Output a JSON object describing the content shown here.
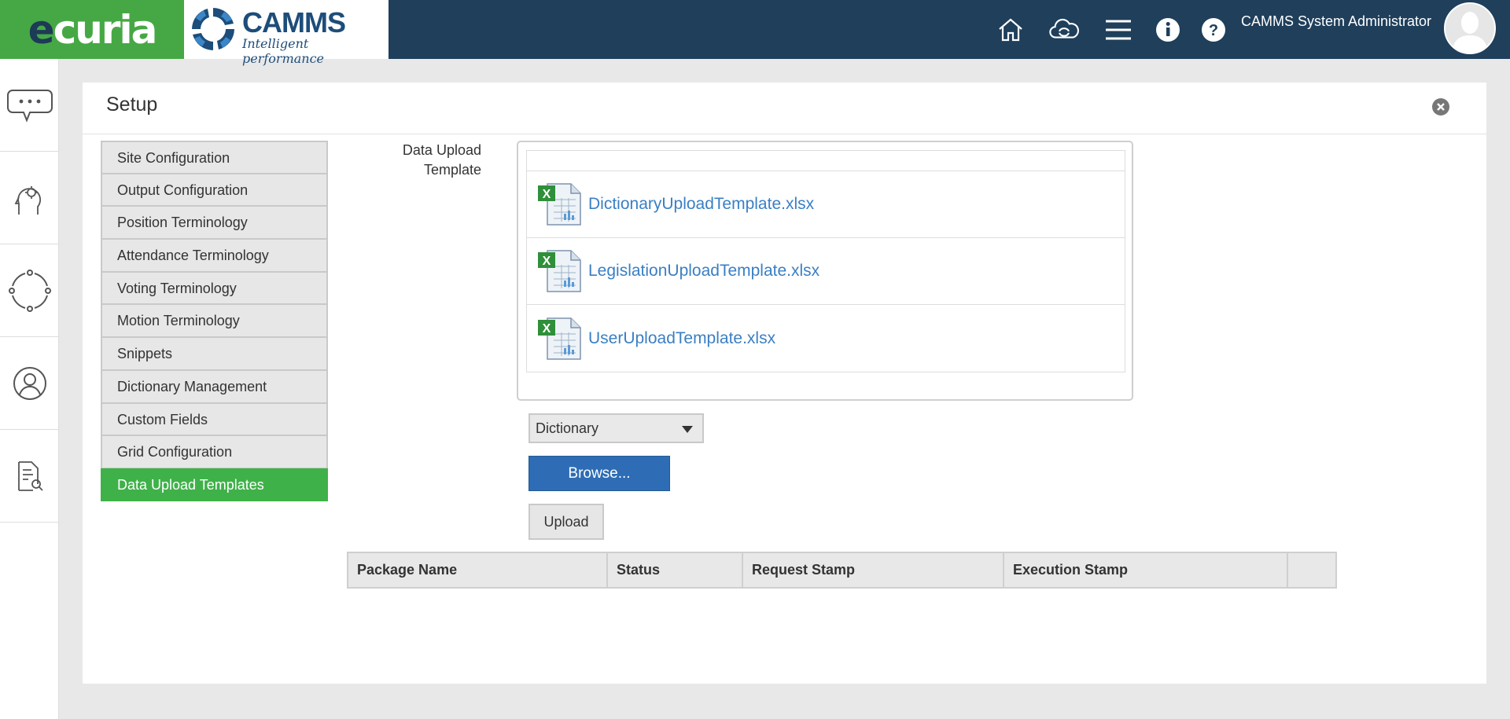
{
  "header": {
    "brand": "ecuria",
    "camms_brand": "CAMMS",
    "camms_tagline": "Intelligent performance",
    "user_name": "CAMMS System Administrator",
    "icons": [
      "home-icon",
      "cloud-sync-icon",
      "menu-icon",
      "info-icon",
      "help-icon"
    ]
  },
  "sidebar": {
    "icons": [
      "chat-icon",
      "settings-brain-icon",
      "cycle-icon",
      "user-icon",
      "document-search-icon"
    ]
  },
  "panel": {
    "title": "Setup"
  },
  "setup_menu": {
    "items": [
      {
        "label": "Site Configuration",
        "active": false
      },
      {
        "label": "Output Configuration",
        "active": false
      },
      {
        "label": "Position Terminology",
        "active": false
      },
      {
        "label": "Attendance Terminology",
        "active": false
      },
      {
        "label": "Voting Terminology",
        "active": false
      },
      {
        "label": "Motion Terminology",
        "active": false
      },
      {
        "label": "Snippets",
        "active": false
      },
      {
        "label": "Dictionary Management",
        "active": false
      },
      {
        "label": "Custom Fields",
        "active": false
      },
      {
        "label": "Grid Configuration",
        "active": false
      },
      {
        "label": "Data Upload Templates",
        "active": true
      }
    ]
  },
  "templates": {
    "label_line1": "Data Upload",
    "label_line2": "Template",
    "files": [
      "DictionaryUploadTemplate.xlsx",
      "LegislationUploadTemplate.xlsx",
      "UserUploadTemplate.xlsx"
    ]
  },
  "controls": {
    "type_select_value": "Dictionary",
    "browse_label": "Browse...",
    "upload_label": "Upload"
  },
  "grid": {
    "columns": [
      "Package Name",
      "Status",
      "Request Stamp",
      "Execution Stamp",
      ""
    ]
  },
  "colors": {
    "topbar": "#1f3f5b",
    "brand_green": "#46a845",
    "active_green": "#3fb149",
    "link_blue": "#3a7fc4",
    "button_blue": "#2e6db5"
  }
}
